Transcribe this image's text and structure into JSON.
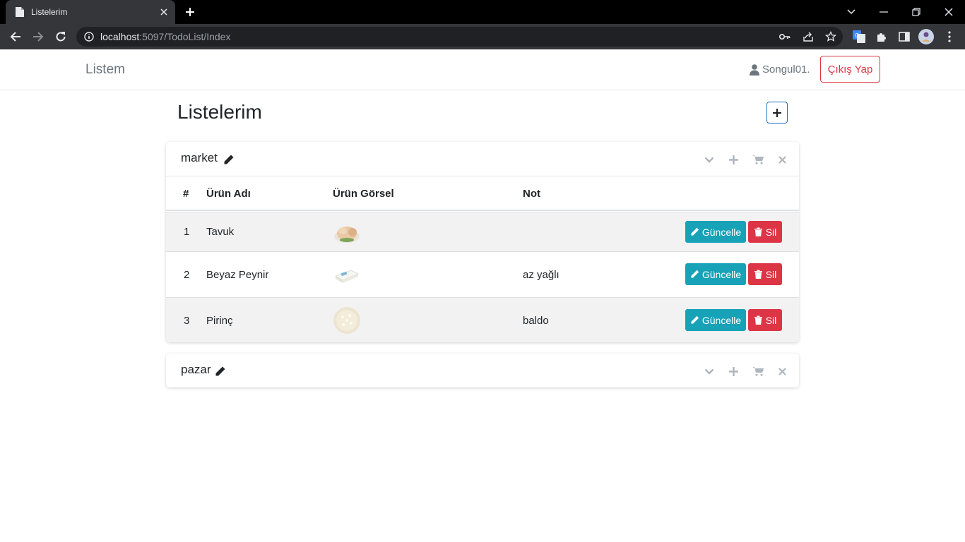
{
  "browser": {
    "tab_title": "Listelerim",
    "url_host": "localhost",
    "url_rest": ":5097/TodoList/Index"
  },
  "app": {
    "brand": "Listem",
    "username": "Songul01.",
    "logout_label": "Çıkış Yap",
    "page_title": "Listelerim"
  },
  "lists": [
    {
      "name": "market",
      "columns": {
        "index": "#",
        "name": "Ürün Adı",
        "image": "Ürün Görsel",
        "note": "Not"
      },
      "items": [
        {
          "no": "1",
          "name": "Tavuk",
          "image": "chicken",
          "note": ""
        },
        {
          "no": "2",
          "name": "Beyaz Peynir",
          "image": "white-cheese",
          "note": "az yağlı"
        },
        {
          "no": "3",
          "name": "Pirinç",
          "image": "rice",
          "note": "baldo"
        }
      ],
      "update_label": "Güncelle",
      "delete_label": "Sil"
    },
    {
      "name": "pazar",
      "items": []
    }
  ],
  "colors": {
    "accent_update": "#17a2b8",
    "accent_delete": "#dc3545",
    "logout_border": "#dc3545"
  }
}
